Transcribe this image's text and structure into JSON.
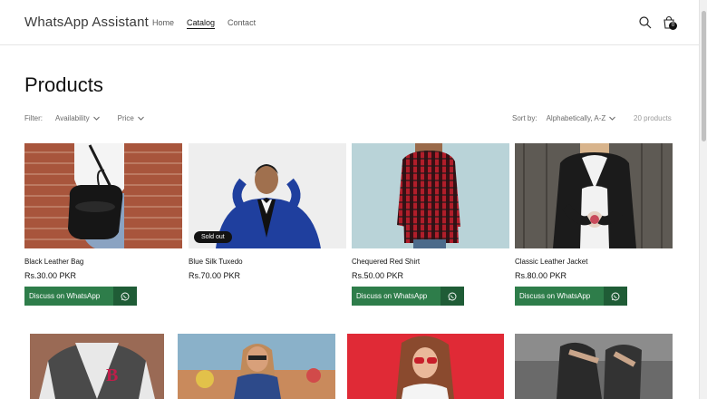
{
  "header": {
    "logo": "WhatsApp Assistant",
    "nav": [
      "Home",
      "Catalog",
      "Contact"
    ],
    "active_nav": "Catalog",
    "cart_count": "0"
  },
  "page": {
    "title": "Products"
  },
  "filters": {
    "label": "Filter:",
    "availability": "Availability",
    "price": "Price",
    "sort_label": "Sort by:",
    "sort_value": "Alphabetically, A-Z",
    "product_count": "20 products"
  },
  "products": [
    {
      "name": "Black Leather Bag",
      "price": "Rs.30.00 PKR",
      "button": "Discuss on WhatsApp",
      "badge": ""
    },
    {
      "name": "Blue Silk Tuxedo",
      "price": "Rs.70.00 PKR",
      "button": "",
      "badge": "Sold out"
    },
    {
      "name": "Chequered Red Shirt",
      "price": "Rs.50.00 PKR",
      "button": "Discuss on WhatsApp",
      "badge": ""
    },
    {
      "name": "Classic Leather Jacket",
      "price": "Rs.80.00 PKR",
      "button": "Discuss on WhatsApp",
      "badge": ""
    }
  ],
  "colors": {
    "whatsapp_button": "#2e7d4a",
    "whatsapp_icon_bg": "#1f5c36"
  }
}
